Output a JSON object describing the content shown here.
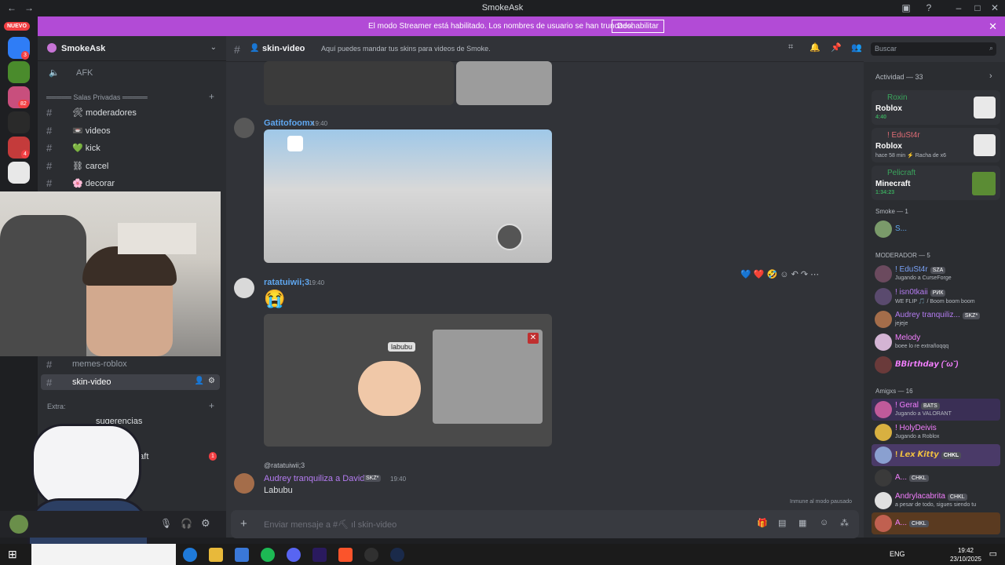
{
  "window": {
    "title": "SmokeAsk"
  },
  "banner": {
    "text": "El modo Streamer está habilitado. Los nombres de usuario se han truncado.",
    "button": "Deshabilitar"
  },
  "guilds": {
    "new_badge": "NUEVO",
    "badges": [
      "3",
      "82",
      "4"
    ]
  },
  "server": {
    "name": "SmokeAsk"
  },
  "channels": {
    "afk": "AFK",
    "category_private": "═════ Salas Privadas ═════",
    "items": [
      {
        "icon": "🛠",
        "name": "moderadores"
      },
      {
        "icon": "📼",
        "name": "videos"
      },
      {
        "icon": "💚",
        "name": "kick"
      },
      {
        "icon": "⛓",
        "name": "carcel"
      },
      {
        "icon": "🌸",
        "name": "decorar"
      }
    ],
    "memes": "memes-roblox",
    "skin": "skin-video",
    "category_extra": "Extra:",
    "sugerencias": "sugerencias",
    "minecraft": "craft",
    "minecraft_badge": "1"
  },
  "header": {
    "channel": "skin-video",
    "topic": "Aquí puedes mandar tus skins para videos de Smoke.",
    "search_placeholder": "Buscar"
  },
  "messages": [
    {
      "author": "Gatitofoomx",
      "time": "19:40",
      "author_color": "#5fa7f0"
    },
    {
      "author": "ratatuiwii;3",
      "time": "19:40",
      "author_color": "#5fa7f0",
      "emoji": "😭",
      "overlay_label": "labubu"
    },
    {
      "reply_to": "@ratatuiwii;3",
      "author": "Audrey tranquiliza a David",
      "tag": "SKZ*",
      "time": "19:40",
      "text": "Labubu",
      "author_color": "#b57cf2"
    }
  ],
  "composer": {
    "placeholder": "Enviar mensaje a #⛏ ıl skin-video",
    "paused": "Inmune al modo pausado"
  },
  "members": {
    "activity_title": "Actividad — 33",
    "activities": [
      {
        "name": "Roxin",
        "game": "Roblox",
        "detail": "4:40",
        "color": "#3ba55d"
      },
      {
        "name": "! EduSt4r",
        "game": "Roblox",
        "detail": "hace 58 min  ⚡ Racha de x6",
        "color": "#e06c75"
      },
      {
        "name": "Pelicraft",
        "game": "Minecraft",
        "detail": "1:34:23",
        "color": "#3ba55d"
      }
    ],
    "smoke_title": "Smoke — 1",
    "smoke_member": "S...",
    "mod_title": "MODERADOR — 5",
    "mods": [
      {
        "name": "! EduSt4r",
        "tag": "SZA",
        "status": "Jugando a CurseForge",
        "color": "#7aa2f7"
      },
      {
        "name": "! isn0tkaii",
        "tag": "РИК",
        "status": "WE FLIP 🎵 / Boom boom boom",
        "color": "#b57cf2"
      },
      {
        "name": "Audrey tranquiliz...",
        "tag": "SKZ*",
        "status": "jejeje",
        "color": "#b57cf2"
      },
      {
        "name": "Melody",
        "tag": "",
        "status": "boee lo re extrañoqqq",
        "color": "#f47fff"
      },
      {
        "name": "𝘽𝘽𝙞𝙧𝙩𝙝𝙙𝙖𝙮 (˘ω˘)",
        "tag": "",
        "status": "",
        "color": "#f47fff"
      }
    ],
    "amigxs_title": "Amigxs — 16",
    "amigxs": [
      {
        "name": "! Geral",
        "tag": "BATS",
        "status": "Jugando a VALORANT",
        "color": "#f47fff"
      },
      {
        "name": "! HolyDeivis",
        "tag": "",
        "status": "Jugando a Roblox",
        "color": "#f47fff"
      },
      {
        "name": "! 𝙇𝙚𝙭 𝙆𝙞𝙩𝙩𝙮",
        "tag": "CHKL",
        "status": "",
        "color": "#f0c040"
      },
      {
        "name": "A...",
        "tag": "CHKL",
        "status": "",
        "color": "#f47fff"
      },
      {
        "name": "Andrylacabrita",
        "tag": "CHKL",
        "status": "a pesar de todo, sigues siendo tu",
        "color": "#f47fff"
      },
      {
        "name": "A...",
        "tag": "CHKL",
        "status": "",
        "color": "#f47fff"
      }
    ]
  },
  "taskbar": {
    "lang": "ENG",
    "time": "19:42",
    "date": "23/10/2025"
  }
}
